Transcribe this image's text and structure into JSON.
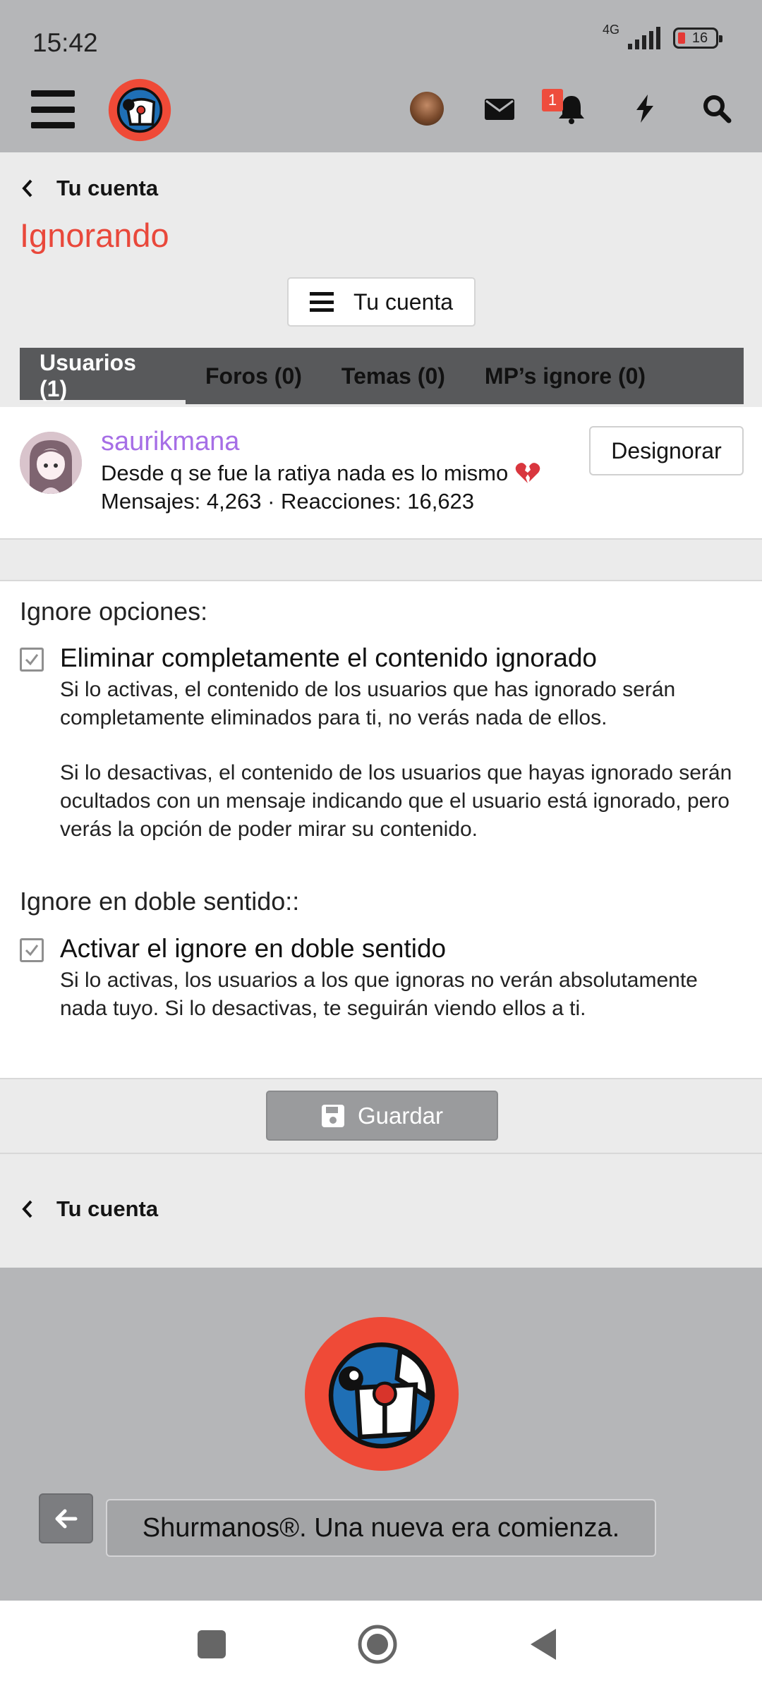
{
  "status_bar": {
    "time": "15:42",
    "network": "4G",
    "battery": "16"
  },
  "header": {
    "notification_count": "1"
  },
  "page": {
    "breadcrumb": "Tu cuenta",
    "title": "Ignorando",
    "menu_button": "Tu cuenta"
  },
  "tabs": [
    {
      "label": "Usuarios (1)"
    },
    {
      "label": "Foros (0)"
    },
    {
      "label": "Temas (0)"
    },
    {
      "label": "MP’s ignore (0)"
    }
  ],
  "ignored_user": {
    "username": "saurikmana",
    "status": "Desde q se fue la ratiya nada es lo mismo",
    "stats": "Mensajes: 4,263 · Reacciones: 16,623",
    "unignore_button": "Designorar"
  },
  "options": {
    "section1_title": "Ignore opciones:",
    "opt1_label": "Eliminar completamente el contenido ignorado",
    "opt1_checked": true,
    "opt1_hint1": "Si lo activas, el contenido de los usuarios que has ignorado serán completamente eliminados para ti, no verás nada de ellos.",
    "opt1_hint2": "Si lo desactivas, el contenido de los usuarios que hayas ignorado serán ocultados con un mensaje indicando que el usuario está ignorado, pero verás la opción de poder mirar su contenido.",
    "section2_title": "Ignore en doble sentido::",
    "opt2_label": "Activar el ignore en doble sentido",
    "opt2_checked": true,
    "opt2_hint": "Si lo activas, los usuarios a los que ignoras no verán absolutamente nada tuyo. Si lo desactivas, te seguirán viendo ellos a ti."
  },
  "save_button": "Guardar",
  "footer": {
    "breadcrumb": "Tu cuenta",
    "tagline": "Shurmanos®. Una nueva era comienza."
  },
  "colors": {
    "accent": "#e9483b",
    "username": "#a66ee6",
    "tab_bar": "#58595b",
    "header_bg": "#b5b6b8"
  }
}
